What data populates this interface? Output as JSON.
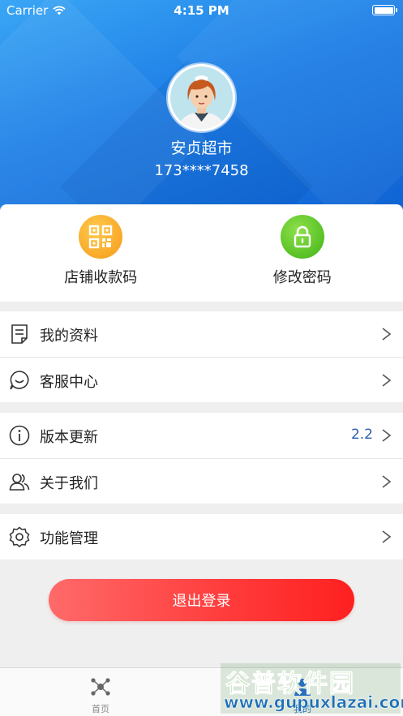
{
  "status_bar": {
    "carrier": "Carrier",
    "time": "4:15 PM"
  },
  "profile": {
    "shop_name": "安贞超市",
    "phone": "173****7458"
  },
  "quick_actions": [
    {
      "label": "店铺收款码",
      "icon": "qr-code-icon",
      "color": "#f7a21e"
    },
    {
      "label": "修改密码",
      "icon": "lock-icon",
      "color": "#4fbf1f"
    }
  ],
  "menu_groups": [
    [
      {
        "label": "我的资料",
        "icon": "document-icon"
      },
      {
        "label": "客服中心",
        "icon": "chat-icon"
      }
    ],
    [
      {
        "label": "版本更新",
        "icon": "info-icon",
        "value": "2.2"
      },
      {
        "label": "关于我们",
        "icon": "users-icon"
      }
    ],
    [
      {
        "label": "功能管理",
        "icon": "settings-icon"
      }
    ]
  ],
  "logout_label": "退出登录",
  "tabs": [
    {
      "label": "首页",
      "icon": "molecule-icon"
    },
    {
      "label": "我的",
      "icon": "profile-icon",
      "active": true
    }
  ],
  "watermark": {
    "title": "谷普软件园",
    "url": "www.gupuxlazai.com"
  },
  "colors": {
    "header": "#1e7fe6",
    "logout": "#ff3a3a",
    "version_text": "#2a5db0"
  }
}
